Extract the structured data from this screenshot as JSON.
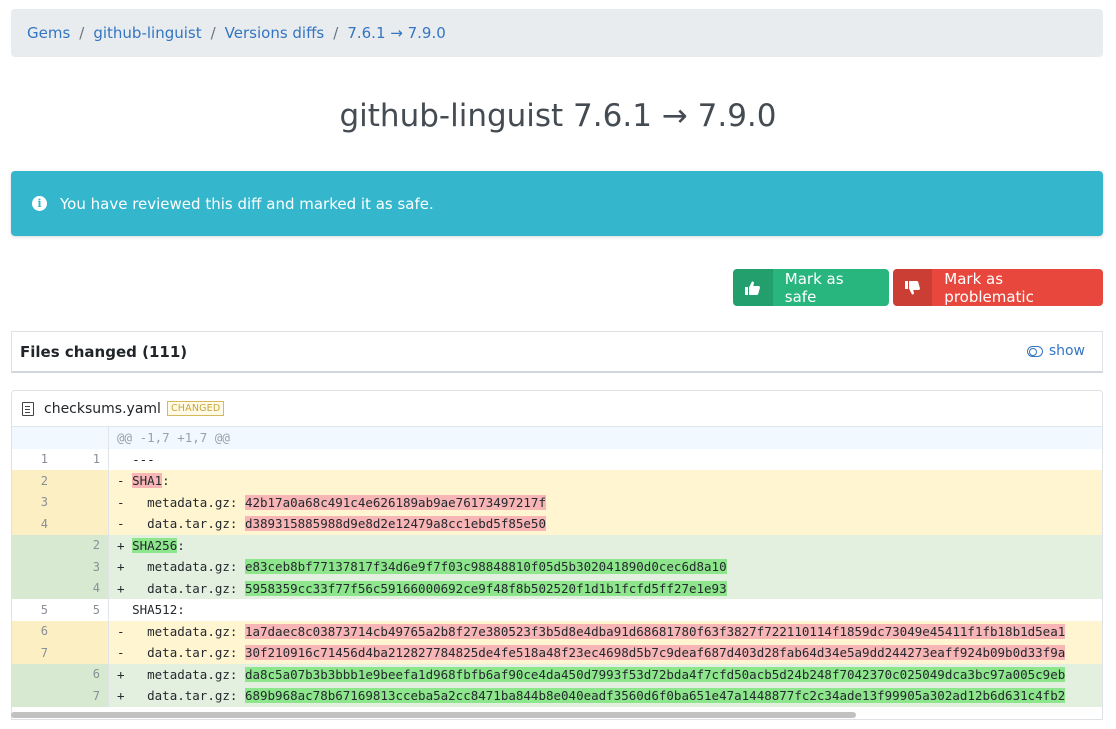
{
  "breadcrumb": {
    "items": [
      "Gems",
      "github-linguist",
      "Versions diffs",
      "7.6.1 → 7.9.0"
    ],
    "separator": "/"
  },
  "page_title": "github-linguist 7.6.1 → 7.9.0",
  "alert": {
    "icon": "info-circle-icon",
    "message": "You have reviewed this diff and marked it as safe.",
    "color": "#34b6cd"
  },
  "actions": {
    "safe_label": "Mark as safe",
    "safe_icon": "thumbs-up-icon",
    "safe_color": "#28b67e",
    "problem_label": "Mark as problematic",
    "problem_icon": "thumbs-down-icon",
    "problem_color": "#e7473c"
  },
  "files_changed": {
    "label": "Files changed (111)",
    "toggle_label": "show"
  },
  "file": {
    "name": "checksums.yaml",
    "status_badge": "CHANGED",
    "hunk_header": "@@ -1,7 +1,7 @@",
    "lines": [
      {
        "type": "ctx",
        "old": "1",
        "new": "1",
        "sign": " ",
        "text": "---"
      },
      {
        "type": "del",
        "old": "2",
        "new": "",
        "sign": "-",
        "key": "SHA1",
        "rest": ":"
      },
      {
        "type": "del",
        "old": "3",
        "new": "",
        "sign": "-",
        "prefix": "  metadata.gz: ",
        "hash": "42b17a0a68c491c4e626189ab9ae76173497217f"
      },
      {
        "type": "del",
        "old": "4",
        "new": "",
        "sign": "-",
        "prefix": "  data.tar.gz: ",
        "hash": "d389315885988d9e8d2e12479a8cc1ebd5f85e50"
      },
      {
        "type": "add",
        "old": "",
        "new": "2",
        "sign": "+",
        "key": "SHA256",
        "rest": ":"
      },
      {
        "type": "add",
        "old": "",
        "new": "3",
        "sign": "+",
        "prefix": "  metadata.gz: ",
        "hash": "e83ceb8bf77137817f34d6e9f7f03c98848810f05d5b302041890d0cec6d8a10"
      },
      {
        "type": "add",
        "old": "",
        "new": "4",
        "sign": "+",
        "prefix": "  data.tar.gz: ",
        "hash": "5958359cc33f77f56c59166000692ce9f48f8b502520f1d1b1fcfd5ff27e1e93"
      },
      {
        "type": "ctx",
        "old": "5",
        "new": "5",
        "sign": " ",
        "text": "SHA512:"
      },
      {
        "type": "del",
        "old": "6",
        "new": "",
        "sign": "-",
        "prefix": "  metadata.gz: ",
        "hash": "1a7daec8c03873714cb49765a2b8f27e380523f3b5d8e4dba91d68681780f63f3827f722110114f1859dc73049e45411f1fb18b1d5ea1"
      },
      {
        "type": "del",
        "old": "7",
        "new": "",
        "sign": "-",
        "prefix": "  data.tar.gz: ",
        "hash": "30f210916c71456d4ba212827784825de4fe518a48f23ec4698d5b7c9deaf687d403d28fab64d34e5a9dd244273eaff924b09b0d33f9a"
      },
      {
        "type": "add",
        "old": "",
        "new": "6",
        "sign": "+",
        "prefix": "  metadata.gz: ",
        "hash": "da8c5a07b3b3bbb1e9beefa1d968fbfb6af90ce4da450d7993f53d72bda4f7cfd50acb5d24b248f7042370c025049dca3bc97a005c9eb"
      },
      {
        "type": "add",
        "old": "",
        "new": "7",
        "sign": "+",
        "prefix": "  data.tar.gz: ",
        "hash": "689b968ac78b67169813cceba5a2cc8471ba844b8e040eadf3560d6f0ba651e47a1448877fc2c34ade13f99905a302ad12b6d631c4fb2"
      }
    ]
  }
}
